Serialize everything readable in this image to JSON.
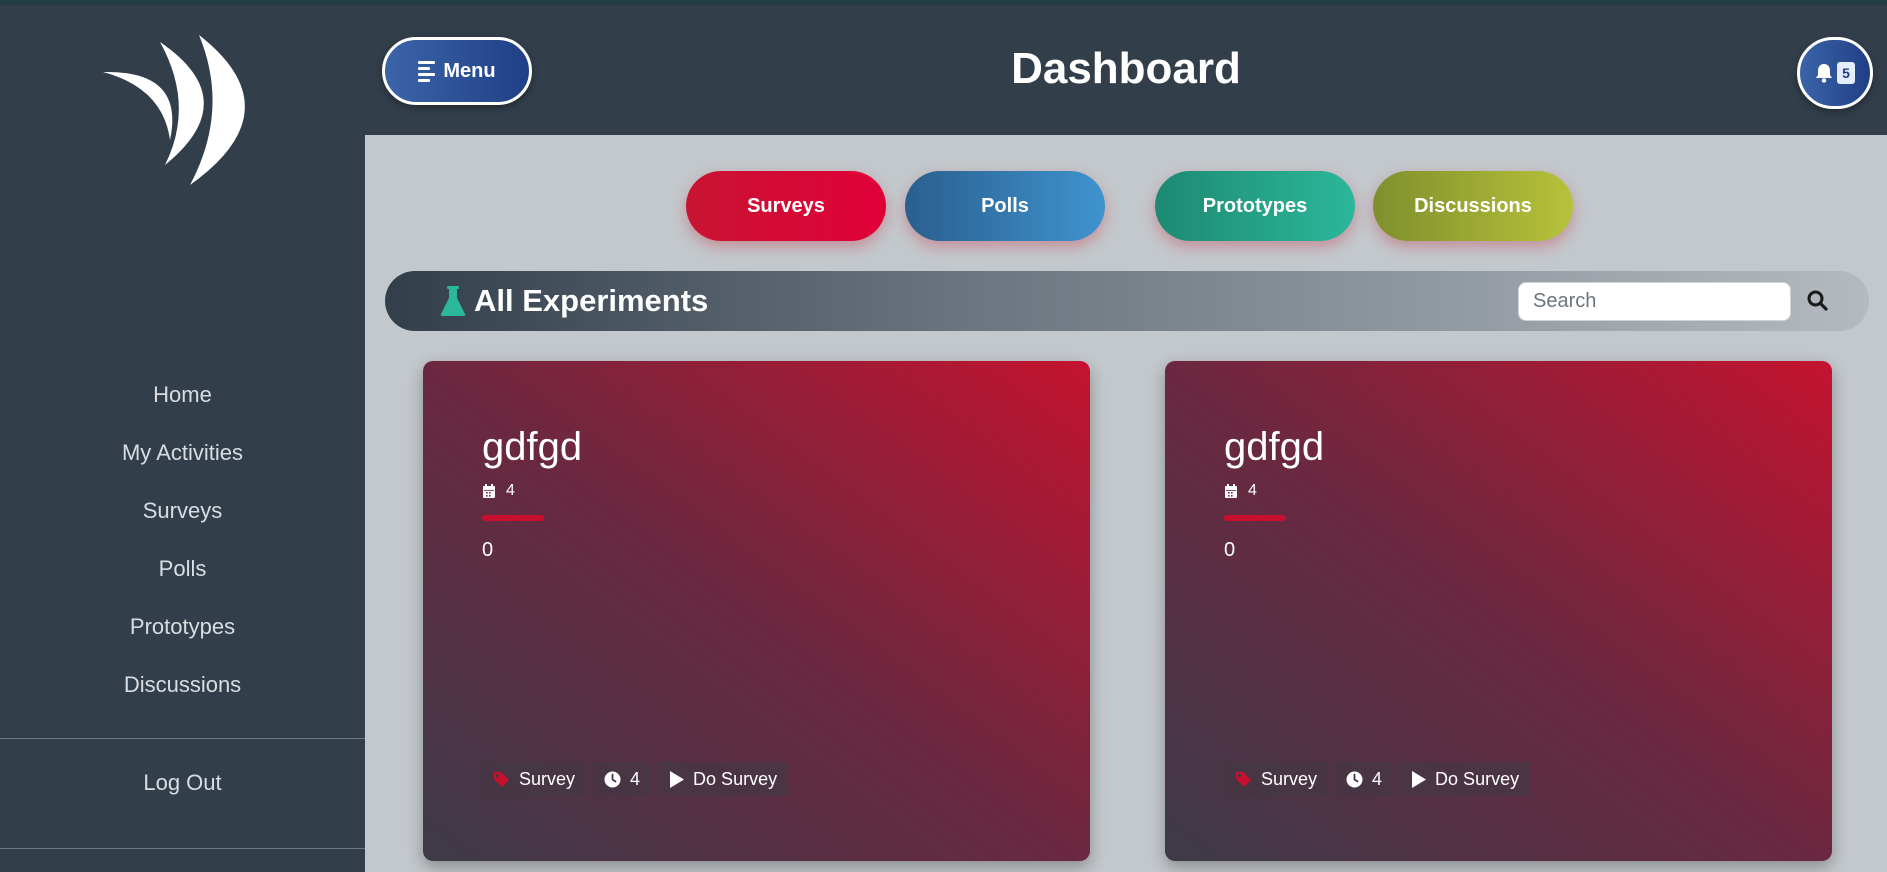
{
  "header": {
    "title": "Dashboard",
    "menu_label": "Menu",
    "notification_count": "5"
  },
  "sidebar": {
    "items": [
      {
        "label": "Home"
      },
      {
        "label": "My Activities"
      },
      {
        "label": "Surveys"
      },
      {
        "label": "Polls"
      },
      {
        "label": "Prototypes"
      },
      {
        "label": "Discussions"
      }
    ],
    "logout_label": "Log Out"
  },
  "categories": [
    {
      "label": "Surveys",
      "color": "#e00038"
    },
    {
      "label": "Polls",
      "color": "#3e93cf"
    },
    {
      "label": "Prototypes",
      "color": "#2cb79a"
    },
    {
      "label": "Discussions",
      "color": "#b7c23a"
    }
  ],
  "experiments": {
    "title": "All Experiments",
    "search_placeholder": "Search",
    "cards": [
      {
        "title": "gdfgd",
        "date": "4",
        "count": "0",
        "type": "Survey",
        "time": "4",
        "action": "Do Survey"
      },
      {
        "title": "gdfgd",
        "date": "4",
        "count": "0",
        "type": "Survey",
        "time": "4",
        "action": "Do Survey"
      }
    ]
  },
  "colors": {
    "sidebar_bg": "#323f4b",
    "accent_red": "#c8102e",
    "flask_green": "#2cb79a",
    "menu_blue": "#2f54a0"
  },
  "icons": [
    "logo-crescent",
    "menu-lines-icon",
    "bell-icon",
    "flask-icon",
    "search-icon",
    "calendar-icon",
    "tag-icon",
    "clock-icon",
    "play-icon"
  ]
}
